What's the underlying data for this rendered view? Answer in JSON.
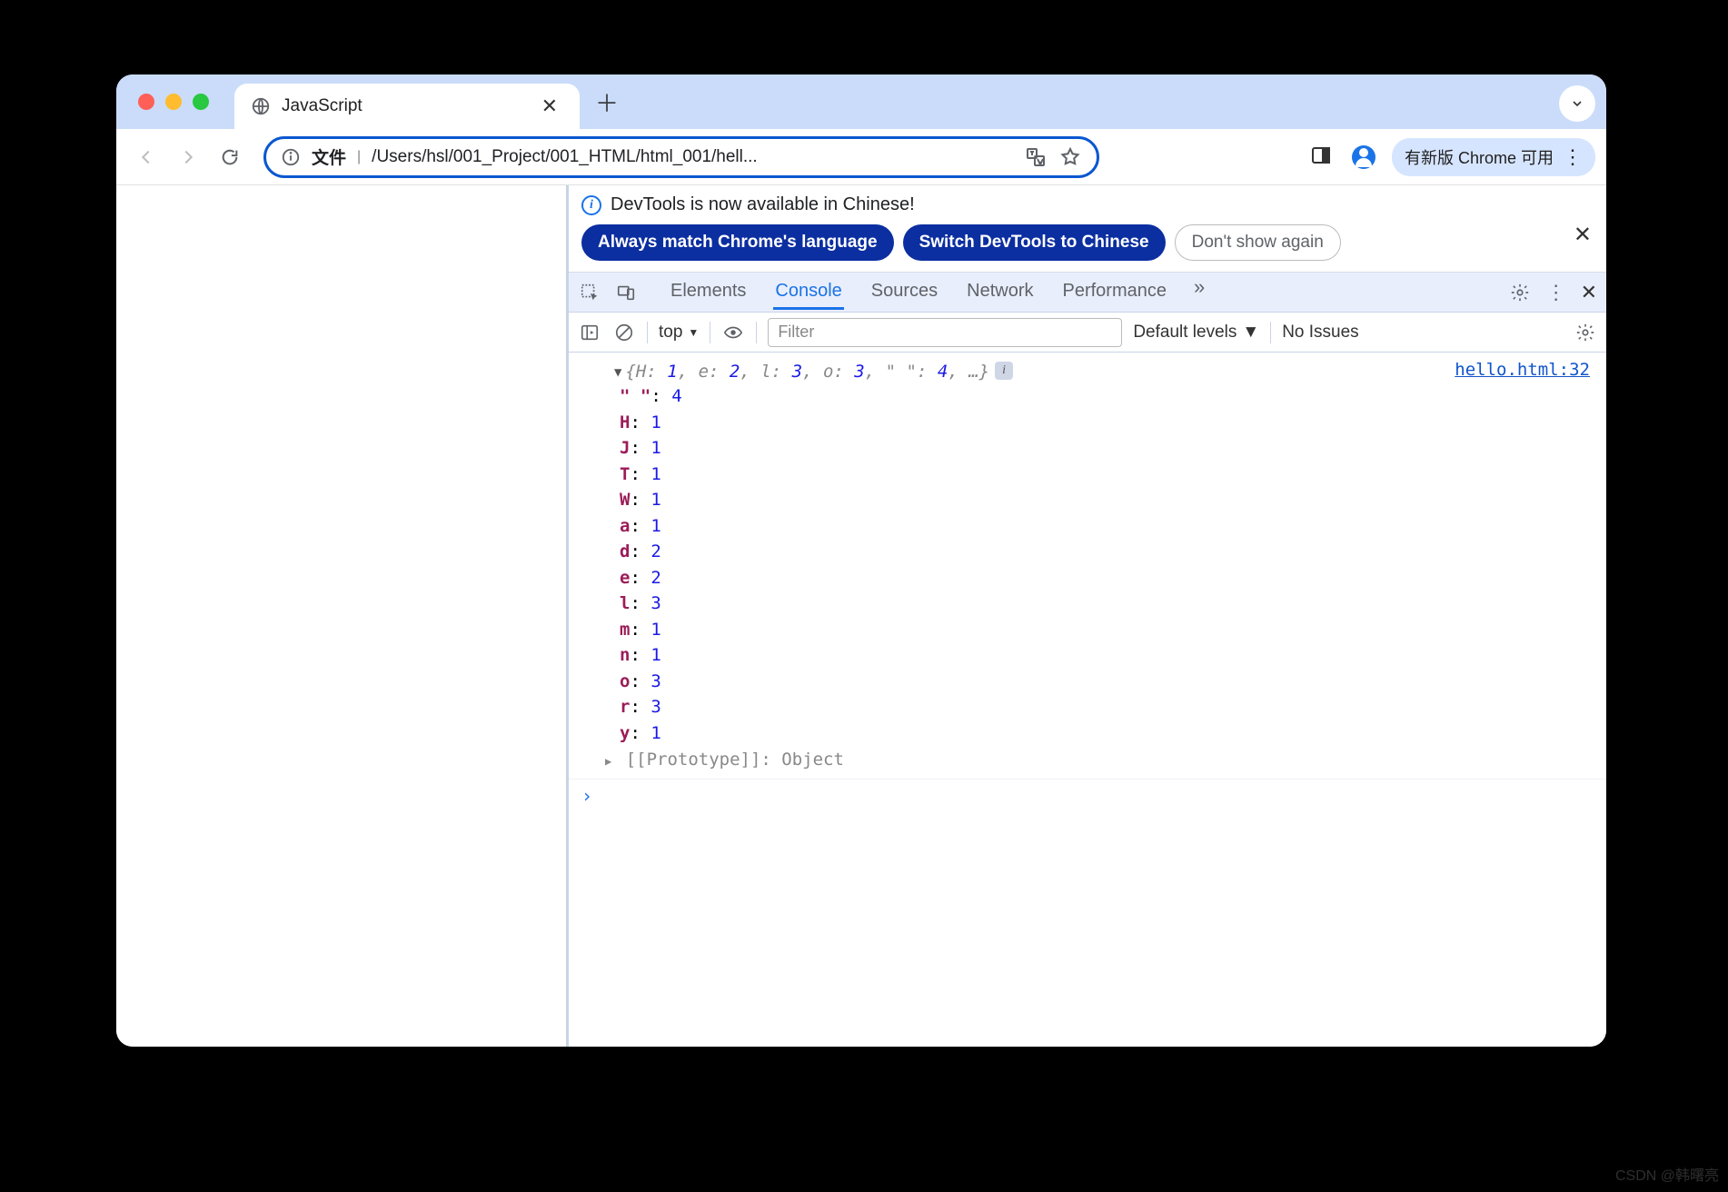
{
  "tab": {
    "title": "JavaScript"
  },
  "toolbar": {
    "scheme": "文件",
    "url": "/Users/hsl/001_Project/001_HTML/html_001/hell...",
    "update_text": "有新版 Chrome 可用"
  },
  "banner": {
    "text": "DevTools is now available in Chinese!",
    "btn_match": "Always match Chrome's language",
    "btn_switch": "Switch DevTools to Chinese",
    "btn_dismiss": "Don't show again"
  },
  "devtools": {
    "tabs": {
      "elements": "Elements",
      "console": "Console",
      "sources": "Sources",
      "network": "Network",
      "performance": "Performance"
    }
  },
  "console": {
    "context": "top",
    "filter_placeholder": "Filter",
    "levels": "Default levels",
    "issues": "No Issues",
    "source_link": "hello.html:32",
    "summary": "{H: 1, e: 2, l: 3, o: 3, \" \": 4, …}",
    "props": [
      {
        "k": "\" \"",
        "v": "4"
      },
      {
        "k": "H",
        "v": "1"
      },
      {
        "k": "J",
        "v": "1"
      },
      {
        "k": "T",
        "v": "1"
      },
      {
        "k": "W",
        "v": "1"
      },
      {
        "k": "a",
        "v": "1"
      },
      {
        "k": "d",
        "v": "2"
      },
      {
        "k": "e",
        "v": "2"
      },
      {
        "k": "l",
        "v": "3"
      },
      {
        "k": "m",
        "v": "1"
      },
      {
        "k": "n",
        "v": "1"
      },
      {
        "k": "o",
        "v": "3"
      },
      {
        "k": "r",
        "v": "3"
      },
      {
        "k": "y",
        "v": "1"
      }
    ],
    "proto_label": "[[Prototype]]",
    "proto_value": "Object"
  },
  "watermark": "CSDN @韩曙亮"
}
